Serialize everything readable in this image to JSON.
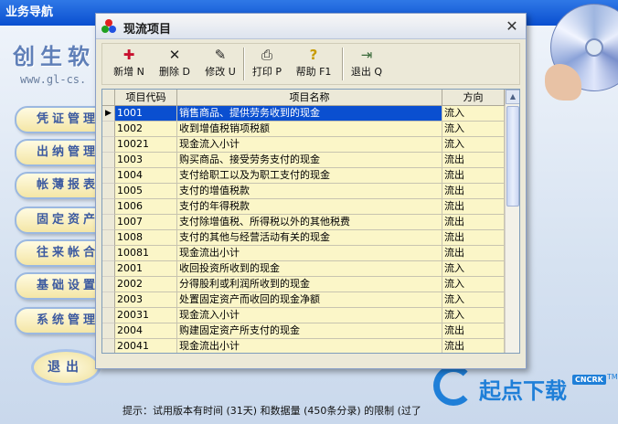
{
  "app": {
    "title": "业务导航",
    "brand": "创生软",
    "site": "www.gl-cs.",
    "nav": [
      "凭证管理",
      "出纳管理",
      "帐薄报表",
      "固定资产",
      "往来帐合",
      "基础设置",
      "系统管理"
    ],
    "exit_label": "退出",
    "status_hint": "提示：试用版本有时间 (31天) 和数据量 (450条分录) 的限制 (过了",
    "watermark": {
      "text": "起点下载",
      "badge": "CNCRK",
      "tm": "TM"
    }
  },
  "dialog": {
    "title": "现流项目",
    "close_glyph": "✕",
    "toolbar": [
      {
        "name": "new",
        "icon": "✚",
        "label": "新增 N",
        "color": "#c8102e"
      },
      {
        "name": "delete",
        "icon": "✕",
        "label": "删除 D",
        "color": "#222222"
      },
      {
        "name": "edit",
        "icon": "✎",
        "label": "修改 U",
        "color": "#222222"
      },
      {
        "name": "print",
        "icon": "⎙",
        "label": "打印 P",
        "color": "#222222"
      },
      {
        "name": "help",
        "icon": "?",
        "label": "帮助 F1",
        "color": "#c89b00"
      },
      {
        "name": "exit",
        "icon": "⇥",
        "label": "退出 Q",
        "color": "#3a6a3a"
      }
    ],
    "grid": {
      "columns": [
        "项目代码",
        "项目名称",
        "方向"
      ],
      "selected_row": 0,
      "row_marker": "▶",
      "rows": [
        [
          "1001",
          "销售商品、提供劳务收到的现金",
          "流入"
        ],
        [
          "1002",
          "收到增值税销项税额",
          "流入"
        ],
        [
          "10021",
          "现金流入小计",
          "流入"
        ],
        [
          "1003",
          "购买商品、接受劳务支付的现金",
          "流出"
        ],
        [
          "1004",
          "支付给职工以及为职工支付的现金",
          "流出"
        ],
        [
          "1005",
          "支付的增值税款",
          "流出"
        ],
        [
          "1006",
          "支付的年得税款",
          "流出"
        ],
        [
          "1007",
          "支付除增值税、所得税以外的其他税费",
          "流出"
        ],
        [
          "1008",
          "支付的其他与经营活动有关的现金",
          "流出"
        ],
        [
          "10081",
          "现金流出小计",
          "流出"
        ],
        [
          "2001",
          "收回投资所收到的现金",
          "流入"
        ],
        [
          "2002",
          "分得股利或利润所收到的现金",
          "流入"
        ],
        [
          "2003",
          "处置固定资产而收回的现金净额",
          "流入"
        ],
        [
          "20031",
          "现金流入小计",
          "流入"
        ],
        [
          "2004",
          "购建固定资产所支付的现金",
          "流出"
        ],
        [
          "20041",
          "现金流出小计",
          "流出"
        ]
      ]
    }
  }
}
